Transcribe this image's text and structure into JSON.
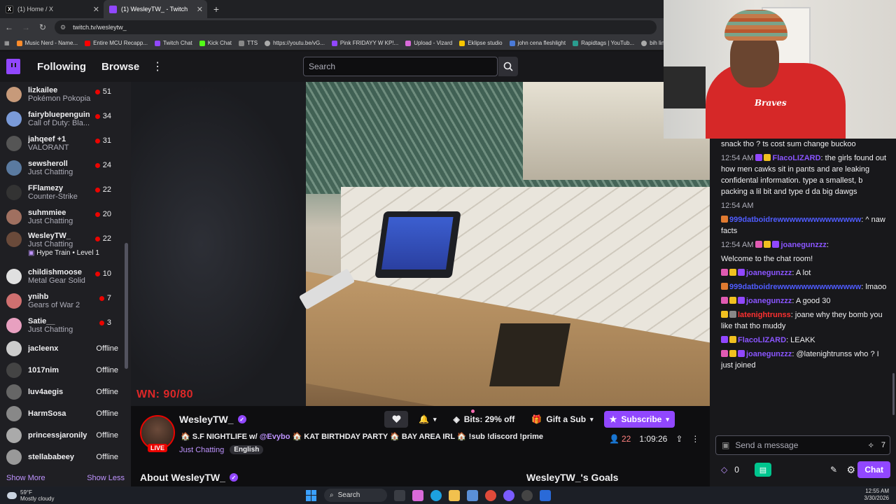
{
  "browser": {
    "tabs": [
      {
        "title": "(1) Home / X",
        "favicon": "x-icon"
      },
      {
        "title": "(1) WesleyTW_ - Twitch",
        "favicon": "twitch-icon"
      }
    ],
    "url": "twitch.tv/wesleytw_",
    "bookmarks": [
      "Music Nerd - Name...",
      "Entire MCU Recapp...",
      "Twitch Chat",
      "Kick Chat",
      "TTS",
      "https://youtu.be/vG...",
      "Pink FRIDAYY W KP!...",
      "Upload - Vizard",
      "Eklipse studio",
      "john cena fleshlight",
      "Rapidtags | YouTub...",
      "bih links"
    ]
  },
  "nav": {
    "following": "Following",
    "browse": "Browse",
    "search_placeholder": "Search"
  },
  "sidebar": {
    "channels": [
      {
        "name": "lizkailee",
        "game": "Pokémon Pokopia",
        "viewers": "51",
        "color": "#c79a7a"
      },
      {
        "name": "fairybluepenguin",
        "game": "Call of Duty: Bla...",
        "viewers": "34",
        "color": "#7a9ad8"
      },
      {
        "name": "jahqeef +1",
        "game": "VALORANT",
        "viewers": "31",
        "color": "#555"
      },
      {
        "name": "sewsheroll",
        "game": "Just Chatting",
        "viewers": "24",
        "color": "#5a7aa0"
      },
      {
        "name": "FFlamezy",
        "game": "Counter-Strike",
        "viewers": "22",
        "color": "#333"
      },
      {
        "name": "suhmmiee",
        "game": "Just Chatting",
        "viewers": "20",
        "color": "#a07060"
      },
      {
        "name": "WesleyTW_",
        "game": "Just Chatting",
        "viewers": "22",
        "hype": "Hype Train • Level 1",
        "color": "#6a4a3a"
      },
      {
        "name": "childishmoose",
        "game": "Metal Gear Solid",
        "viewers": "10",
        "color": "#e0e0e0"
      },
      {
        "name": "ynihb",
        "game": "Gears of War 2",
        "viewers": "7",
        "color": "#d07070"
      },
      {
        "name": "Satie__",
        "game": "Just Chatting",
        "viewers": "3",
        "color": "#e8a0c0"
      }
    ],
    "offline": [
      {
        "name": "jacleenx",
        "status": "Offline",
        "color": "#ccc"
      },
      {
        "name": "1017nim",
        "status": "Offline",
        "color": "#444"
      },
      {
        "name": "luv4aegis",
        "status": "Offline",
        "color": "#666"
      },
      {
        "name": "HarmSosa",
        "status": "Offline",
        "color": "#888"
      },
      {
        "name": "princessjaronily",
        "status": "Offline",
        "color": "#aaa"
      },
      {
        "name": "stellababeey",
        "status": "Offline",
        "color": "#999"
      }
    ],
    "show_more": "Show More",
    "show_less": "Show Less"
  },
  "video": {
    "overlay_text": "WN: 90/80"
  },
  "stream": {
    "channel": "WesleyTW_",
    "live_badge": "LIVE",
    "title_parts": [
      "🏠 S.F NIGHTLIFE w/ ",
      "@Evybo",
      " 🏠 KAT BIRTHDAY PARTY 🏠 BAY AREA IRL 🏠 !sub !discord !prime"
    ],
    "category": "Just Chatting",
    "tag": "English",
    "bits_label": "Bits: 29% off",
    "gift_label": "Gift a Sub",
    "subscribe_label": "Subscribe",
    "viewers": "22",
    "uptime": "1:09:26",
    "about": "About WesleyTW_",
    "goals": "WesleyTW_'s Goals"
  },
  "chat": {
    "messages": [
      {
        "time": "",
        "badges": [],
        "user": "",
        "user_class": "",
        "text": "snack tho ? ts cost sum change buckoo"
      },
      {
        "time": "12:54 AM",
        "badges": [
          "b-purple",
          "b-gold"
        ],
        "user": "FlacoLIZARD",
        "user_class": "u-violet",
        "text": ": the girls found out how men cawks sit in pants and are leaking confidental information. type a smallest, b packing a lil bit and type d da big dawgs"
      },
      {
        "time": "12:54 AM",
        "badges": [],
        "user": "",
        "user_class": "",
        "text": ""
      },
      {
        "time": "",
        "badges": [
          "b-orange"
        ],
        "user": "999datboidrewwwwwwwwwwwwww",
        "user_class": "u-blue",
        "text": ": ^ naw facts"
      },
      {
        "time": "12:54 AM",
        "badges": [
          "b-pink",
          "b-gold",
          "b-purple"
        ],
        "user": "joanegunzzz",
        "user_class": "u-violet",
        "text": ": "
      },
      {
        "time": "",
        "badges": [],
        "user": "",
        "user_class": "",
        "text": "Welcome to the chat room!"
      },
      {
        "time": "",
        "badges": [
          "b-pink",
          "b-gold",
          "b-purple"
        ],
        "user": "joanegunzzz",
        "user_class": "u-violet",
        "text": ": A lot"
      },
      {
        "time": "",
        "badges": [
          "b-orange"
        ],
        "user": "999datboidrewwwwwwwwwwwwww",
        "user_class": "u-blue",
        "text": ": lmaoo"
      },
      {
        "time": "",
        "badges": [
          "b-pink",
          "b-gold",
          "b-purple"
        ],
        "user": "joanegunzzz",
        "user_class": "u-violet",
        "text": ": A good 30"
      },
      {
        "time": "",
        "badges": [
          "b-gold",
          "b-gray"
        ],
        "user": "latenightrunss",
        "user_class": "u-red",
        "text": ": joane why they bomb you like that tho muddy"
      },
      {
        "time": "",
        "badges": [
          "b-purple",
          "b-gold"
        ],
        "user": "FlacoLIZARD",
        "user_class": "u-violet",
        "text": ": LEAKK"
      },
      {
        "time": "",
        "badges": [
          "b-pink",
          "b-gold",
          "b-purple"
        ],
        "user": "joanegunzzz",
        "user_class": "u-violet",
        "text": ": @latenightrunss who ? I just joined"
      }
    ],
    "input_placeholder": "Send a message",
    "points": "0",
    "chat_button": "Chat"
  },
  "webcam": {
    "jersey_text": "Braves"
  },
  "taskbar": {
    "temp": "59°F",
    "weather": "Mostly cloudy",
    "search": "Search",
    "time": "12:55 AM",
    "date": "3/30/2026"
  }
}
